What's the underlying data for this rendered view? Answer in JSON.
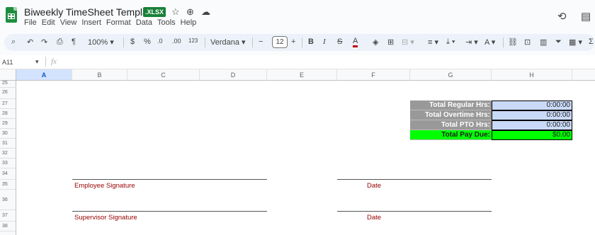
{
  "doc": {
    "title": "Biweekly TimeSheet Template",
    "badge": ".XLSX",
    "menu": [
      "File",
      "Edit",
      "View",
      "Insert",
      "Format",
      "Data",
      "Tools",
      "Help"
    ]
  },
  "toolbar": {
    "zoom": "100%",
    "currency": "$",
    "percent": "%",
    "dec_decrease": ".0",
    "dec_increase": ".00",
    "number_format": "123",
    "font": "Verdana",
    "font_size": "12"
  },
  "formula_bar": {
    "cell_ref": "A11",
    "fx": "fx"
  },
  "columns": [
    "A",
    "B",
    "C",
    "D",
    "E",
    "F",
    "G",
    "H"
  ],
  "rows": [
    "25",
    "26",
    "27",
    "28",
    "29",
    "30",
    "31",
    "32",
    "33",
    "34",
    "35",
    "36",
    "37",
    "38"
  ],
  "summary": [
    {
      "label": "Total Regular Hrs:",
      "value": "0:00:00"
    },
    {
      "label": "Total Overtime Hrs:",
      "value": "0:00:00"
    },
    {
      "label": "Total PTO Hrs:",
      "value": "0:00:00"
    },
    {
      "label": "Total Pay Due:",
      "value": "$0.00"
    }
  ],
  "signatures": {
    "employee": "Employee Signature",
    "supervisor": "Supervisor Signature",
    "date1": "Date",
    "date2": "Date"
  }
}
